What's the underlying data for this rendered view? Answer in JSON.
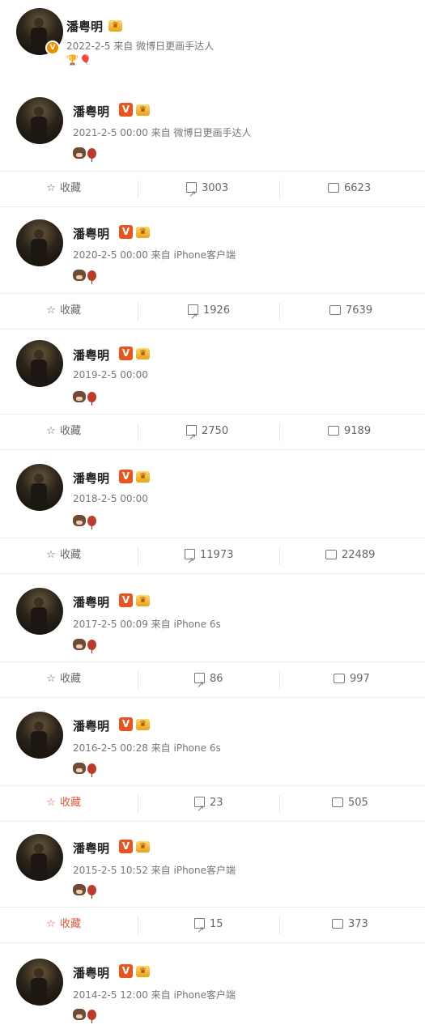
{
  "posts": [
    {
      "username": "潘粤明",
      "meta": "2022-2-5 来自 微博日更画手达人",
      "emoji": "🦍🎈",
      "actions": null
    },
    {
      "username": "潘粤明",
      "meta": "2021-2-5 00:00 来自 微博日更画手达人",
      "emoji": "🐮🎈",
      "actions": {
        "fav": "收藏",
        "repost": "3003",
        "comment": "6623"
      }
    },
    {
      "username": "潘粤明",
      "meta": "2020-2-5 00:00 来自 iPhone客户端",
      "emoji": "🐮🎈",
      "actions": {
        "fav": "收藏",
        "repost": "1926",
        "comment": "7639"
      }
    },
    {
      "username": "潘粤明",
      "meta": "2019-2-5 00:00",
      "emoji": "🐮🎈",
      "actions": {
        "fav": "收藏",
        "repost": "2750",
        "comment": "9189"
      }
    },
    {
      "username": "潘粤明",
      "meta": "2018-2-5 00:00",
      "emoji": "🐮🎈",
      "actions": {
        "fav": "收藏",
        "repost": "11973",
        "comment": "22489"
      }
    },
    {
      "username": "潘粤明",
      "meta": "2017-2-5 00:09 来自 iPhone 6s",
      "emoji": "🐮🎈",
      "actions": {
        "fav": "收藏",
        "repost": "86",
        "comment": "997"
      }
    },
    {
      "username": "潘粤明",
      "meta": "2016-2-5 00:28 来自 iPhone 6s",
      "emoji": "🐮🎈",
      "actions": {
        "fav": "收藏",
        "repost": "23",
        "comment": "505"
      }
    },
    {
      "username": "潘粤明",
      "meta": "2015-2-5 10:52 来自 iPhone客户端",
      "emoji": "🐮🎈",
      "actions": {
        "fav": "收藏",
        "repost": "15",
        "comment": "373"
      }
    },
    {
      "username": "潘粤明",
      "meta": "2014-2-5 12:00 来自 iPhone客户端",
      "emoji": "🐮🎈",
      "actions": null
    }
  ],
  "colors": {
    "accent": "#e8563b",
    "vip": "#e8531e",
    "text_meta": "#777777"
  },
  "icons": [
    "star-icon",
    "repost-icon",
    "comment-icon",
    "verified-v-icon",
    "crown-icon"
  ]
}
